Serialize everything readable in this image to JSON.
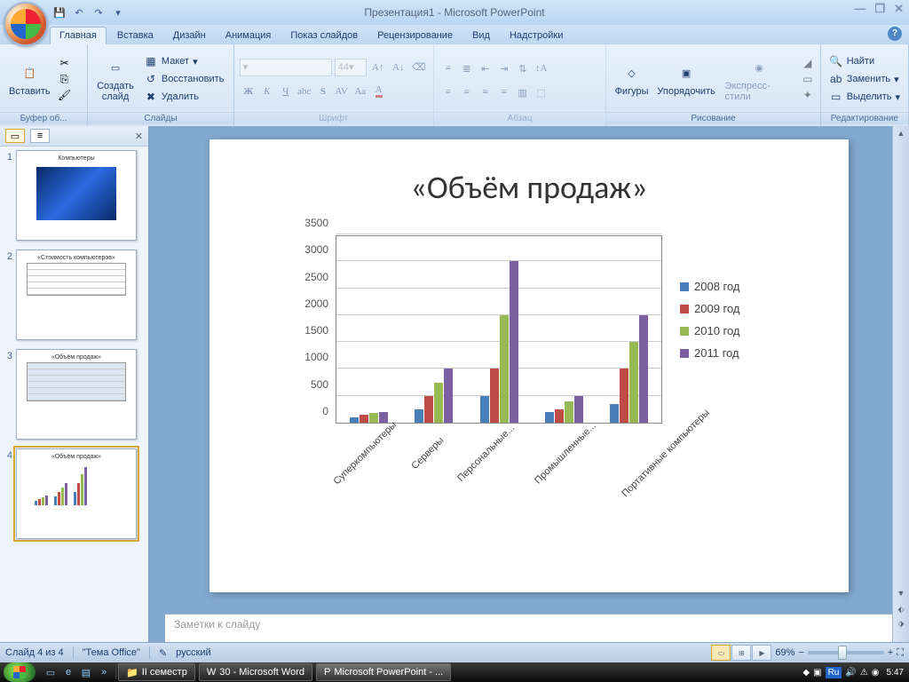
{
  "window": {
    "title": "Презентация1 - Microsoft PowerPoint"
  },
  "tabs": {
    "home": "Главная",
    "insert": "Вставка",
    "design": "Дизайн",
    "animation": "Анимация",
    "slideshow": "Показ слайдов",
    "review": "Рецензирование",
    "view": "Вид",
    "addins": "Надстройки"
  },
  "ribbon": {
    "clipboard": {
      "paste": "Вставить",
      "label": "Буфер об..."
    },
    "slides": {
      "new_slide": "Создать\nслайд",
      "layout": "Макет",
      "reset": "Восстановить",
      "delete": "Удалить",
      "label": "Слайды"
    },
    "font": {
      "size": "44",
      "label": "Шрифт"
    },
    "paragraph": {
      "label": "Абзац"
    },
    "drawing": {
      "shapes": "Фигуры",
      "arrange": "Упорядочить",
      "styles": "Экспресс-стили",
      "label": "Рисование"
    },
    "editing": {
      "find": "Найти",
      "replace": "Заменить",
      "select": "Выделить",
      "label": "Редактирование"
    }
  },
  "thumbs": {
    "t1": "Компьютеры",
    "t2": "«Стоимость компьютеров»",
    "t3": "«Объём продаж»",
    "t4": "«Объём продаж»"
  },
  "slide": {
    "title": "«Объём продаж»"
  },
  "chart_data": {
    "type": "bar",
    "categories": [
      "Суперкомпьютеры",
      "Серверы",
      "Персональные...",
      "Промышленные...",
      "Портативные компьютеры"
    ],
    "series": [
      {
        "name": "2008 год",
        "color": "#4a7ebb",
        "values": [
          100,
          250,
          500,
          200,
          350
        ]
      },
      {
        "name": "2009 год",
        "color": "#be4b48",
        "values": [
          150,
          500,
          1000,
          250,
          1000
        ]
      },
      {
        "name": "2010 год",
        "color": "#98b954",
        "values": [
          180,
          750,
          2000,
          400,
          1500
        ]
      },
      {
        "name": "2011 год",
        "color": "#7d60a0",
        "values": [
          200,
          1000,
          3000,
          500,
          2000
        ]
      }
    ],
    "y_ticks": [
      0,
      500,
      1000,
      1500,
      2000,
      2500,
      3000,
      3500
    ],
    "ymax": 3500
  },
  "notes": {
    "placeholder": "Заметки к слайду"
  },
  "status": {
    "slide": "Слайд 4 из 4",
    "theme": "\"Тема Office\"",
    "lang": "русский",
    "zoom": "69%"
  },
  "taskbar": {
    "task1": "II семестр",
    "task2": "30 - Microsoft Word",
    "task3": "Microsoft PowerPoint - ...",
    "lang": "Ru",
    "clock": "5:47"
  }
}
